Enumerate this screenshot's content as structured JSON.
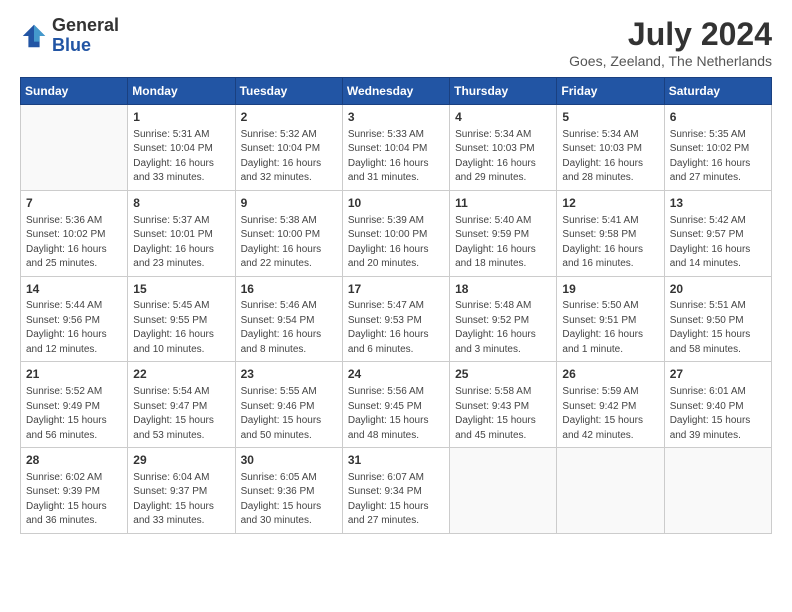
{
  "header": {
    "logo_general": "General",
    "logo_blue": "Blue",
    "month_year": "July 2024",
    "location": "Goes, Zeeland, The Netherlands"
  },
  "days_of_week": [
    "Sunday",
    "Monday",
    "Tuesday",
    "Wednesday",
    "Thursday",
    "Friday",
    "Saturday"
  ],
  "weeks": [
    [
      {
        "day": "",
        "sunrise": "",
        "sunset": "",
        "daylight": ""
      },
      {
        "day": "1",
        "sunrise": "Sunrise: 5:31 AM",
        "sunset": "Sunset: 10:04 PM",
        "daylight": "Daylight: 16 hours and 33 minutes."
      },
      {
        "day": "2",
        "sunrise": "Sunrise: 5:32 AM",
        "sunset": "Sunset: 10:04 PM",
        "daylight": "Daylight: 16 hours and 32 minutes."
      },
      {
        "day": "3",
        "sunrise": "Sunrise: 5:33 AM",
        "sunset": "Sunset: 10:04 PM",
        "daylight": "Daylight: 16 hours and 31 minutes."
      },
      {
        "day": "4",
        "sunrise": "Sunrise: 5:34 AM",
        "sunset": "Sunset: 10:03 PM",
        "daylight": "Daylight: 16 hours and 29 minutes."
      },
      {
        "day": "5",
        "sunrise": "Sunrise: 5:34 AM",
        "sunset": "Sunset: 10:03 PM",
        "daylight": "Daylight: 16 hours and 28 minutes."
      },
      {
        "day": "6",
        "sunrise": "Sunrise: 5:35 AM",
        "sunset": "Sunset: 10:02 PM",
        "daylight": "Daylight: 16 hours and 27 minutes."
      }
    ],
    [
      {
        "day": "7",
        "sunrise": "Sunrise: 5:36 AM",
        "sunset": "Sunset: 10:02 PM",
        "daylight": "Daylight: 16 hours and 25 minutes."
      },
      {
        "day": "8",
        "sunrise": "Sunrise: 5:37 AM",
        "sunset": "Sunset: 10:01 PM",
        "daylight": "Daylight: 16 hours and 23 minutes."
      },
      {
        "day": "9",
        "sunrise": "Sunrise: 5:38 AM",
        "sunset": "Sunset: 10:00 PM",
        "daylight": "Daylight: 16 hours and 22 minutes."
      },
      {
        "day": "10",
        "sunrise": "Sunrise: 5:39 AM",
        "sunset": "Sunset: 10:00 PM",
        "daylight": "Daylight: 16 hours and 20 minutes."
      },
      {
        "day": "11",
        "sunrise": "Sunrise: 5:40 AM",
        "sunset": "Sunset: 9:59 PM",
        "daylight": "Daylight: 16 hours and 18 minutes."
      },
      {
        "day": "12",
        "sunrise": "Sunrise: 5:41 AM",
        "sunset": "Sunset: 9:58 PM",
        "daylight": "Daylight: 16 hours and 16 minutes."
      },
      {
        "day": "13",
        "sunrise": "Sunrise: 5:42 AM",
        "sunset": "Sunset: 9:57 PM",
        "daylight": "Daylight: 16 hours and 14 minutes."
      }
    ],
    [
      {
        "day": "14",
        "sunrise": "Sunrise: 5:44 AM",
        "sunset": "Sunset: 9:56 PM",
        "daylight": "Daylight: 16 hours and 12 minutes."
      },
      {
        "day": "15",
        "sunrise": "Sunrise: 5:45 AM",
        "sunset": "Sunset: 9:55 PM",
        "daylight": "Daylight: 16 hours and 10 minutes."
      },
      {
        "day": "16",
        "sunrise": "Sunrise: 5:46 AM",
        "sunset": "Sunset: 9:54 PM",
        "daylight": "Daylight: 16 hours and 8 minutes."
      },
      {
        "day": "17",
        "sunrise": "Sunrise: 5:47 AM",
        "sunset": "Sunset: 9:53 PM",
        "daylight": "Daylight: 16 hours and 6 minutes."
      },
      {
        "day": "18",
        "sunrise": "Sunrise: 5:48 AM",
        "sunset": "Sunset: 9:52 PM",
        "daylight": "Daylight: 16 hours and 3 minutes."
      },
      {
        "day": "19",
        "sunrise": "Sunrise: 5:50 AM",
        "sunset": "Sunset: 9:51 PM",
        "daylight": "Daylight: 16 hours and 1 minute."
      },
      {
        "day": "20",
        "sunrise": "Sunrise: 5:51 AM",
        "sunset": "Sunset: 9:50 PM",
        "daylight": "Daylight: 15 hours and 58 minutes."
      }
    ],
    [
      {
        "day": "21",
        "sunrise": "Sunrise: 5:52 AM",
        "sunset": "Sunset: 9:49 PM",
        "daylight": "Daylight: 15 hours and 56 minutes."
      },
      {
        "day": "22",
        "sunrise": "Sunrise: 5:54 AM",
        "sunset": "Sunset: 9:47 PM",
        "daylight": "Daylight: 15 hours and 53 minutes."
      },
      {
        "day": "23",
        "sunrise": "Sunrise: 5:55 AM",
        "sunset": "Sunset: 9:46 PM",
        "daylight": "Daylight: 15 hours and 50 minutes."
      },
      {
        "day": "24",
        "sunrise": "Sunrise: 5:56 AM",
        "sunset": "Sunset: 9:45 PM",
        "daylight": "Daylight: 15 hours and 48 minutes."
      },
      {
        "day": "25",
        "sunrise": "Sunrise: 5:58 AM",
        "sunset": "Sunset: 9:43 PM",
        "daylight": "Daylight: 15 hours and 45 minutes."
      },
      {
        "day": "26",
        "sunrise": "Sunrise: 5:59 AM",
        "sunset": "Sunset: 9:42 PM",
        "daylight": "Daylight: 15 hours and 42 minutes."
      },
      {
        "day": "27",
        "sunrise": "Sunrise: 6:01 AM",
        "sunset": "Sunset: 9:40 PM",
        "daylight": "Daylight: 15 hours and 39 minutes."
      }
    ],
    [
      {
        "day": "28",
        "sunrise": "Sunrise: 6:02 AM",
        "sunset": "Sunset: 9:39 PM",
        "daylight": "Daylight: 15 hours and 36 minutes."
      },
      {
        "day": "29",
        "sunrise": "Sunrise: 6:04 AM",
        "sunset": "Sunset: 9:37 PM",
        "daylight": "Daylight: 15 hours and 33 minutes."
      },
      {
        "day": "30",
        "sunrise": "Sunrise: 6:05 AM",
        "sunset": "Sunset: 9:36 PM",
        "daylight": "Daylight: 15 hours and 30 minutes."
      },
      {
        "day": "31",
        "sunrise": "Sunrise: 6:07 AM",
        "sunset": "Sunset: 9:34 PM",
        "daylight": "Daylight: 15 hours and 27 minutes."
      },
      {
        "day": "",
        "sunrise": "",
        "sunset": "",
        "daylight": ""
      },
      {
        "day": "",
        "sunrise": "",
        "sunset": "",
        "daylight": ""
      },
      {
        "day": "",
        "sunrise": "",
        "sunset": "",
        "daylight": ""
      }
    ]
  ]
}
